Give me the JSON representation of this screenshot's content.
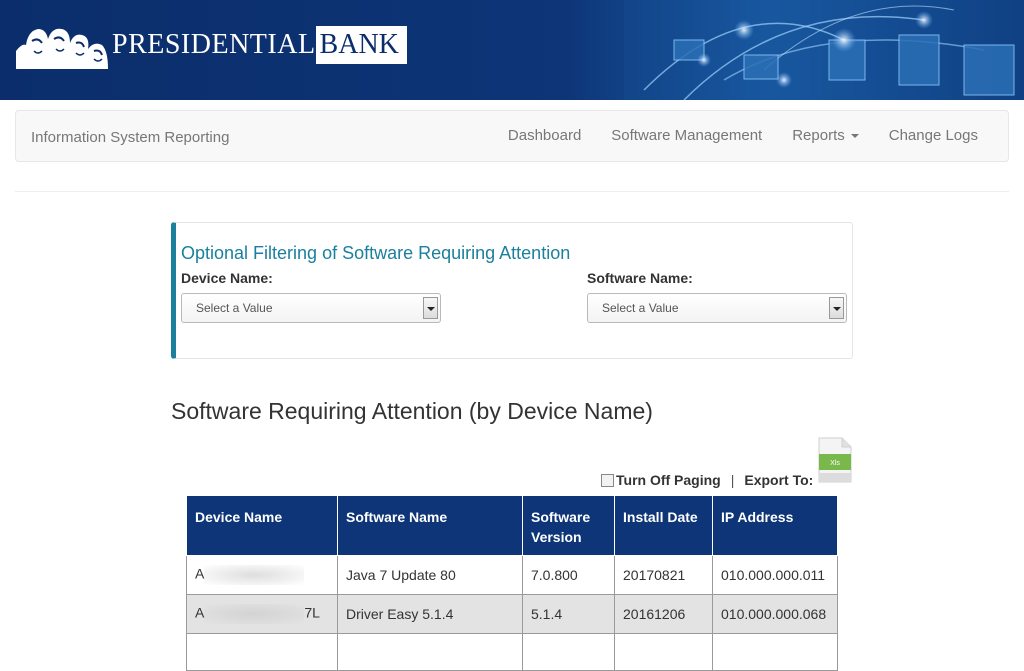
{
  "banner": {
    "logo_word1": "PRESIDENTIAL",
    "logo_word2": "BANK",
    "logo_icon": "mount-rushmore-icon"
  },
  "navbar": {
    "brand": "Information System Reporting",
    "items": [
      {
        "label": "Dashboard"
      },
      {
        "label": "Software Management"
      },
      {
        "label": "Reports"
      },
      {
        "label": "Change Logs"
      }
    ]
  },
  "filter": {
    "title": "Optional Filtering of Software Requiring Attention",
    "device_label": "Device Name:",
    "device_value": "Select a Value",
    "software_label": "Software Name:",
    "software_value": "Select a Value"
  },
  "section_title": "Software Requiring Attention (by Device Name)",
  "paging": {
    "turn_off_paging": "Turn Off Paging",
    "separator": "|",
    "export_to": "Export To:",
    "export_icon": "xls-file-icon",
    "export_icon_text": "Xls"
  },
  "table": {
    "headers": [
      "Device Name",
      "Software Name",
      "Software Version",
      "Install Date",
      "IP Address"
    ],
    "rows": [
      {
        "device_prefix": "A",
        "device_suffix": "",
        "software": "Java 7 Update 80",
        "version": "7.0.800",
        "install_date": "20170821",
        "ip": "010.000.000.011"
      },
      {
        "device_prefix": "A",
        "device_suffix": "7L",
        "software": "Driver Easy 5.1.4",
        "version": "5.1.4",
        "install_date": "20161206",
        "ip": "010.000.000.068"
      }
    ]
  },
  "colors": {
    "banner": "#0d3577",
    "accent": "#1b809e",
    "table_header": "#0d3577",
    "row_alt": "#e3e3e3"
  }
}
